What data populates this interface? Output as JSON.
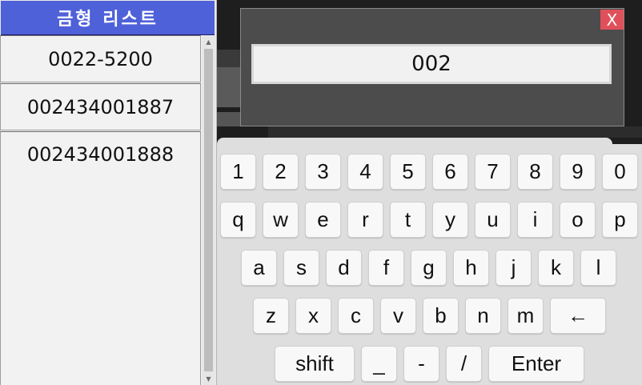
{
  "list": {
    "title": "금형 리스트",
    "items": [
      "0022-5200",
      "002434001887",
      "002434001888"
    ]
  },
  "dialog": {
    "input_value": "002",
    "close_label": "X"
  },
  "keyboard": {
    "row1": [
      "1",
      "2",
      "3",
      "4",
      "5",
      "6",
      "7",
      "8",
      "9",
      "0"
    ],
    "row2": [
      "q",
      "w",
      "e",
      "r",
      "t",
      "y",
      "u",
      "i",
      "o",
      "p"
    ],
    "row3": [
      "a",
      "s",
      "d",
      "f",
      "g",
      "h",
      "j",
      "k",
      "l"
    ],
    "row4": [
      "z",
      "x",
      "c",
      "v",
      "b",
      "n",
      "m",
      "←"
    ],
    "row5": [
      "shift",
      "_",
      "-",
      "/",
      "Enter"
    ]
  },
  "colors": {
    "header_bg": "#4f61d9",
    "close_bg": "#e0505a"
  }
}
